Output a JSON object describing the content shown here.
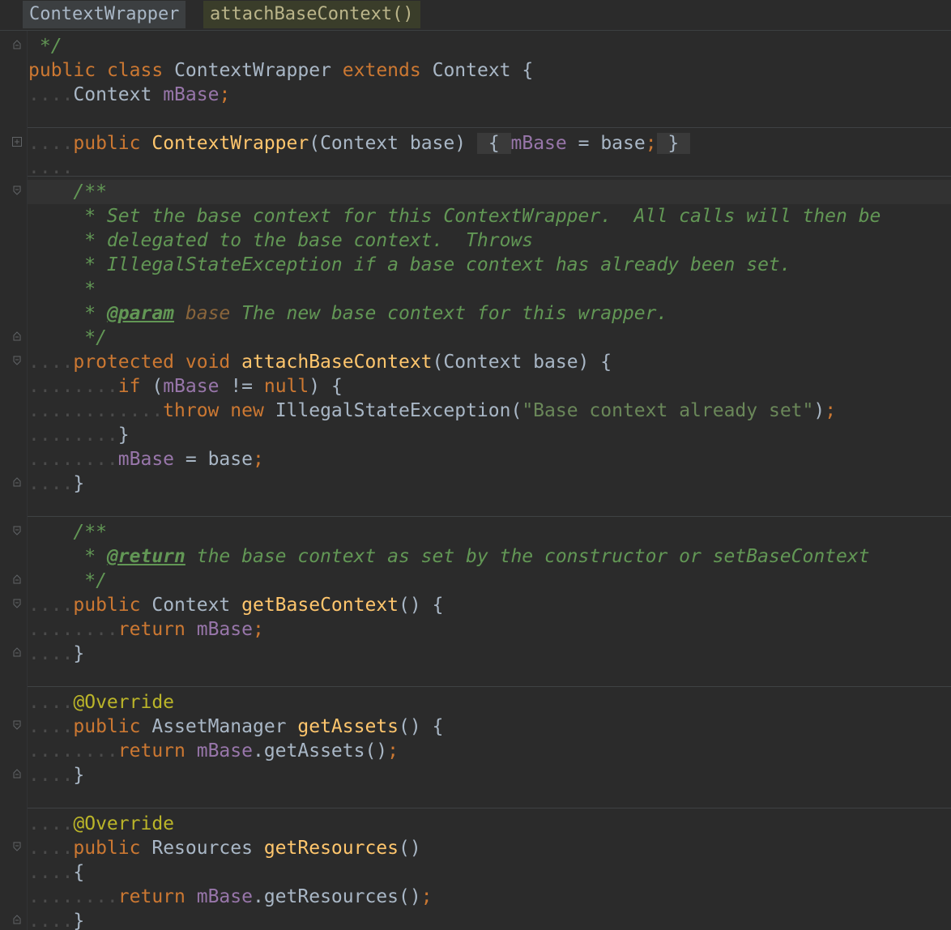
{
  "breadcrumb": {
    "class_name": "ContextWrapper",
    "method_name": "attachBaseContext()"
  },
  "colors": {
    "background": "#2b2b2b",
    "keyword": "#cc7832",
    "function": "#ffc66d",
    "field": "#9876aa",
    "string": "#6a8759",
    "comment": "#629755",
    "annotation": "#bbb529"
  },
  "icons": {
    "fold_open": "fold-collapse-icon",
    "fold_end": "fold-end-icon",
    "fold_closed": "fold-expand-icon"
  },
  "code": {
    "l1": " */",
    "l2": [
      {
        "t": "public",
        "c": "kw"
      },
      {
        "t": " ",
        "c": "ind"
      },
      {
        "t": "class",
        "c": "kw"
      },
      {
        "t": " ",
        "c": "ind"
      },
      {
        "t": "ContextWrapper",
        "c": "cls"
      },
      {
        "t": " ",
        "c": "ind"
      },
      {
        "t": "extends",
        "c": "kw"
      },
      {
        "t": " ",
        "c": "ind"
      },
      {
        "t": "Context",
        "c": "cls"
      },
      {
        "t": " {",
        "c": "cls"
      }
    ],
    "l3": [
      {
        "t": "....",
        "c": "ind"
      },
      {
        "t": "Context",
        "c": "cls"
      },
      {
        "t": " ",
        "c": "ind"
      },
      {
        "t": "mBase",
        "c": "fld"
      },
      {
        "t": ";",
        "c": "kw"
      }
    ],
    "l5": [
      {
        "t": "....",
        "c": "ind"
      },
      {
        "t": "public",
        "c": "kw"
      },
      {
        "t": " ",
        "c": "ind"
      },
      {
        "t": "ContextWrapper",
        "c": "fn"
      },
      {
        "t": "(Context",
        "c": "cls"
      },
      {
        "t": " ",
        "c": "ind"
      },
      {
        "t": "base)",
        "c": "cls"
      },
      {
        "t": " ",
        "c": "ind"
      },
      {
        "t": " { ",
        "c": "fold"
      },
      {
        "t": "mBase",
        "c": "fld"
      },
      {
        "t": " = ",
        "c": "cls"
      },
      {
        "t": "base",
        "c": "cls"
      },
      {
        "t": ";",
        "c": "kw"
      },
      {
        "t": " } ",
        "c": "fold"
      }
    ],
    "l6": "....",
    "c1": "/**",
    "c2": " * Set the base context for this ContextWrapper.  All calls will then be",
    "c3": " * delegated to the base context.  Throws",
    "c4": " * IllegalStateException if a base context has already been set.",
    "c5": " *",
    "c6_pre": " * ",
    "c6_tag": "@param",
    "c6_param": "base",
    "c6_text": " The new base context for this wrapper.",
    "c7": " */",
    "m1": [
      {
        "t": "....",
        "c": "ind"
      },
      {
        "t": "protected",
        "c": "kw"
      },
      {
        "t": " ",
        "c": "ind"
      },
      {
        "t": "void",
        "c": "kw"
      },
      {
        "t": " ",
        "c": "ind"
      },
      {
        "t": "attachBaseContext",
        "c": "fn"
      },
      {
        "t": "(Context",
        "c": "cls"
      },
      {
        "t": " ",
        "c": "ind"
      },
      {
        "t": "base)",
        "c": "cls"
      },
      {
        "t": " ",
        "c": "ind"
      },
      {
        "t": "{",
        "c": "cls"
      }
    ],
    "m2": [
      {
        "t": "........",
        "c": "ind"
      },
      {
        "t": "if",
        "c": "kw"
      },
      {
        "t": " ",
        "c": "ind"
      },
      {
        "t": "(",
        "c": "cls"
      },
      {
        "t": "mBase",
        "c": "fld"
      },
      {
        "t": " ",
        "c": "ind"
      },
      {
        "t": "!=",
        "c": "cls"
      },
      {
        "t": " ",
        "c": "ind"
      },
      {
        "t": "null",
        "c": "kw"
      },
      {
        "t": ")",
        "c": "cls"
      },
      {
        "t": " ",
        "c": "ind"
      },
      {
        "t": "{",
        "c": "cls"
      }
    ],
    "m3": [
      {
        "t": "............",
        "c": "ind"
      },
      {
        "t": "throw",
        "c": "kw"
      },
      {
        "t": " ",
        "c": "ind"
      },
      {
        "t": "new",
        "c": "kw"
      },
      {
        "t": " ",
        "c": "ind"
      },
      {
        "t": "IllegalStateException(",
        "c": "cls"
      },
      {
        "t": "\"Base context already set\"",
        "c": "str"
      },
      {
        "t": ")",
        "c": "cls"
      },
      {
        "t": ";",
        "c": "kw"
      }
    ],
    "m4": [
      {
        "t": "........",
        "c": "ind"
      },
      {
        "t": "}",
        "c": "cls"
      }
    ],
    "m5": [
      {
        "t": "........",
        "c": "ind"
      },
      {
        "t": "mBase",
        "c": "fld"
      },
      {
        "t": " = ",
        "c": "cls"
      },
      {
        "t": "base",
        "c": "cls"
      },
      {
        "t": ";",
        "c": "kw"
      }
    ],
    "m6": [
      {
        "t": "....",
        "c": "ind"
      },
      {
        "t": "}",
        "c": "cls"
      }
    ],
    "r1": "/**",
    "r2_pre": " * ",
    "r2_tag": "@return",
    "r2_text": " the base context as set by the constructor or setBaseContext",
    "r3": " */",
    "g1": [
      {
        "t": "....",
        "c": "ind"
      },
      {
        "t": "public",
        "c": "kw"
      },
      {
        "t": " ",
        "c": "ind"
      },
      {
        "t": "Context",
        "c": "cls"
      },
      {
        "t": " ",
        "c": "ind"
      },
      {
        "t": "getBaseContext",
        "c": "fn"
      },
      {
        "t": "()",
        "c": "cls"
      },
      {
        "t": " ",
        "c": "ind"
      },
      {
        "t": "{",
        "c": "cls"
      }
    ],
    "g2": [
      {
        "t": "........",
        "c": "ind"
      },
      {
        "t": "return",
        "c": "kw"
      },
      {
        "t": " ",
        "c": "ind"
      },
      {
        "t": "mBase",
        "c": "fld"
      },
      {
        "t": ";",
        "c": "kw"
      }
    ],
    "g3": [
      {
        "t": "....",
        "c": "ind"
      },
      {
        "t": "}",
        "c": "cls"
      }
    ],
    "a0": [
      {
        "t": "....",
        "c": "ind"
      },
      {
        "t": "@Override",
        "c": "ann"
      }
    ],
    "a1": [
      {
        "t": "....",
        "c": "ind"
      },
      {
        "t": "public",
        "c": "kw"
      },
      {
        "t": " ",
        "c": "ind"
      },
      {
        "t": "AssetManager",
        "c": "cls"
      },
      {
        "t": " ",
        "c": "ind"
      },
      {
        "t": "getAssets",
        "c": "fn"
      },
      {
        "t": "()",
        "c": "cls"
      },
      {
        "t": " ",
        "c": "ind"
      },
      {
        "t": "{",
        "c": "cls"
      }
    ],
    "a2": [
      {
        "t": "........",
        "c": "ind"
      },
      {
        "t": "return",
        "c": "kw"
      },
      {
        "t": " ",
        "c": "ind"
      },
      {
        "t": "mBase",
        "c": "fld"
      },
      {
        "t": ".getAssets()",
        "c": "cls"
      },
      {
        "t": ";",
        "c": "kw"
      }
    ],
    "a3": [
      {
        "t": "....",
        "c": "ind"
      },
      {
        "t": "}",
        "c": "cls"
      }
    ],
    "b0": [
      {
        "t": "....",
        "c": "ind"
      },
      {
        "t": "@Override",
        "c": "ann"
      }
    ],
    "b1": [
      {
        "t": "....",
        "c": "ind"
      },
      {
        "t": "public",
        "c": "kw"
      },
      {
        "t": " ",
        "c": "ind"
      },
      {
        "t": "Resources",
        "c": "cls"
      },
      {
        "t": " ",
        "c": "ind"
      },
      {
        "t": "getResources",
        "c": "fn"
      },
      {
        "t": "()",
        "c": "cls"
      }
    ],
    "b2": [
      {
        "t": "....",
        "c": "ind"
      },
      {
        "t": "{",
        "c": "cls"
      }
    ],
    "b3": [
      {
        "t": "........",
        "c": "ind"
      },
      {
        "t": "return",
        "c": "kw"
      },
      {
        "t": " ",
        "c": "ind"
      },
      {
        "t": "mBase",
        "c": "fld"
      },
      {
        "t": ".getResources()",
        "c": "cls"
      },
      {
        "t": ";",
        "c": "kw"
      }
    ],
    "b4": [
      {
        "t": "....",
        "c": "ind"
      },
      {
        "t": "}",
        "c": "cls"
      }
    ]
  }
}
